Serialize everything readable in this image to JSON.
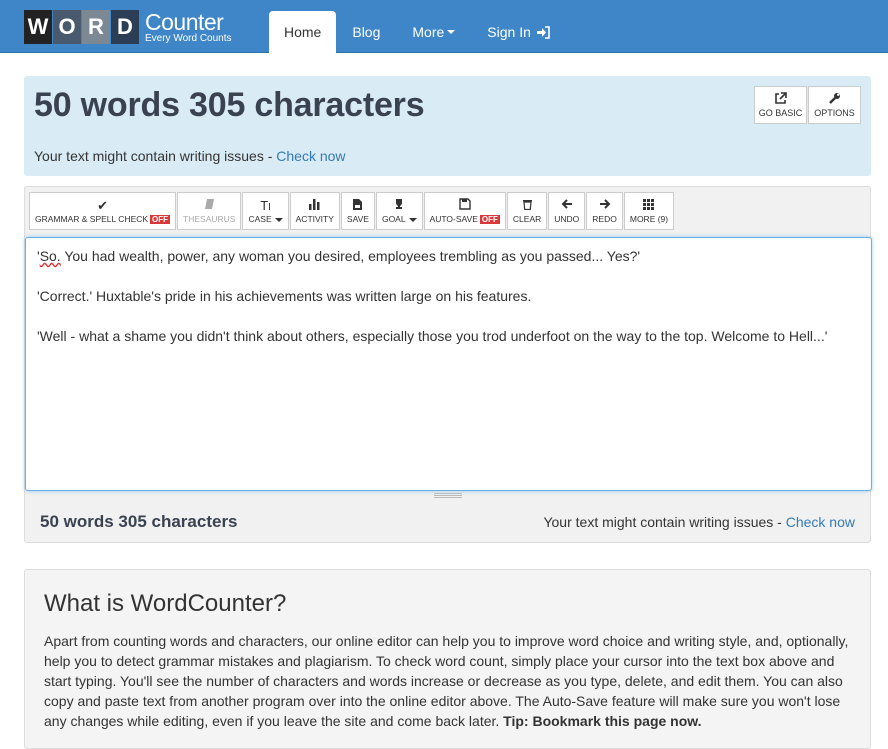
{
  "logo": {
    "letters": [
      "W",
      "O",
      "R",
      "D"
    ],
    "title": "Counter",
    "subtitle": "Every Word Counts"
  },
  "nav": {
    "home": "Home",
    "blog": "Blog",
    "more": "More",
    "signin": "Sign In"
  },
  "header": {
    "count_text": "50 words 305 characters",
    "issues_prefix": "Your text might contain writing issues - ",
    "check_now": "Check now",
    "go_basic": "GO BASIC",
    "options": "OPTIONS"
  },
  "toolbar": {
    "grammar": "GRAMMAR & SPELL CHECK",
    "grammar_badge": "OFF",
    "thesaurus": "THESAURUS",
    "case": "CASE",
    "activity": "ACTIVITY",
    "save": "SAVE",
    "goal": "GOAL",
    "autosave": "AUTO-SAVE",
    "autosave_badge": "OFF",
    "clear": "CLEAR",
    "undo": "UNDO",
    "redo": "REDO",
    "more": "MORE (9)"
  },
  "editor": {
    "line1_a": "'",
    "line1_so": "So.",
    "line1_b": " You had wealth, power, any woman you desired, employees trembling as you passed... Yes?'",
    "line2": "'Correct.' Huxtable's pride in his achievements was written large on his features.",
    "line3": "'Well - what a shame you didn't think about others, especially those you trod underfoot on the way to the top. Welcome to Hell...'"
  },
  "footer_bar": {
    "count_text": "50 words 305 characters",
    "issues_prefix": "Your text might contain writing issues - ",
    "check_now": "Check now"
  },
  "info": {
    "heading": "What is WordCounter?",
    "body": "Apart from counting words and characters, our online editor can help you to improve word choice and writing style, and, optionally, help you to detect grammar mistakes and plagiarism. To check word count, simply place your cursor into the text box above and start typing. You'll see the number of characters and words increase or decrease as you type, delete, and edit them. You can also copy and paste text from another program over into the online editor above. The Auto-Save feature will make sure you won't lose any changes while editing, even if you leave the site and come back later. ",
    "tip": "Tip: Bookmark this page now."
  },
  "colors": {
    "navbar": "#3f86c8",
    "header_panel": "#d9ebf5",
    "link": "#337ab7",
    "off_badge": "#d9383a"
  }
}
